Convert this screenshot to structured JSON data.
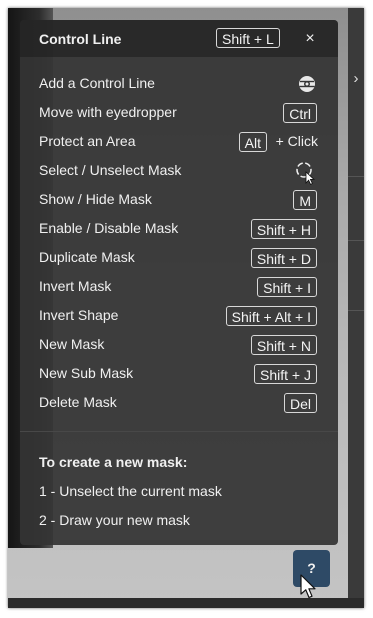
{
  "panel": {
    "title": "Control Line",
    "title_shortcut": "Shift + L",
    "close_glyph": "×",
    "rows": [
      {
        "label": "Add a Control Line",
        "icon": "control-line-icon"
      },
      {
        "label": "Move with eyedropper",
        "key": "Ctrl"
      },
      {
        "label": "Protect an Area",
        "key": "Alt",
        "suffix": "+ Click"
      },
      {
        "label": "Select / Unselect Mask",
        "icon": "lasso-cursor-icon"
      },
      {
        "label": "Show / Hide Mask",
        "key": "M"
      },
      {
        "label": "Enable / Disable Mask",
        "key": "Shift + H"
      },
      {
        "label": "Duplicate Mask",
        "key": "Shift + D"
      },
      {
        "label": "Invert Mask",
        "key": "Shift + I"
      },
      {
        "label": "Invert Shape",
        "key": "Shift + Alt + I"
      },
      {
        "label": "New Mask",
        "key": "Shift + N"
      },
      {
        "label": "New Sub Mask",
        "key": "Shift + J"
      },
      {
        "label": "Delete Mask",
        "key": "Del"
      }
    ],
    "info": {
      "title": "To create a new mask:",
      "lines": [
        "1 - Unselect the current mask",
        "2 - Draw your new mask"
      ]
    }
  },
  "help_button": {
    "label": "?"
  },
  "side_panel": {
    "toggle_icon": "chevron-right-icon",
    "toggle_glyph": "›"
  },
  "colors": {
    "panel_bg": "#343434",
    "help_button_bg": "#2e4a66",
    "text": "#f0f0f0"
  }
}
